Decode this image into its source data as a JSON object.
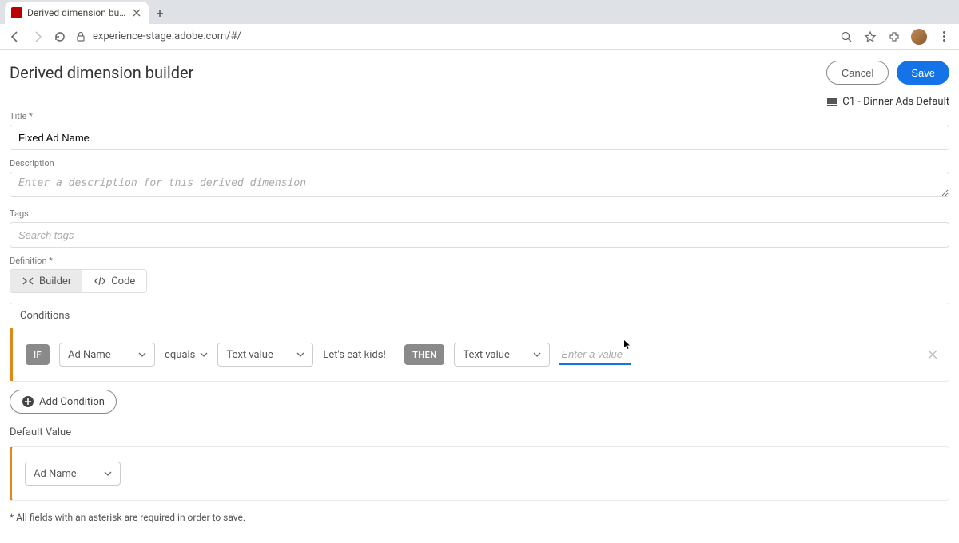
{
  "browser": {
    "tab_title": "Derived dimension builder | Cu",
    "url": "experience-stage.adobe.com/#/"
  },
  "header": {
    "title": "Derived dimension builder",
    "cancel": "Cancel",
    "save": "Save"
  },
  "context": {
    "dataview": "C1 - Dinner Ads Default"
  },
  "fields": {
    "title_label": "Title",
    "title_value": "Fixed Ad Name",
    "description_label": "Description",
    "description_placeholder": "Enter a description for this derived dimension",
    "tags_label": "Tags",
    "tags_placeholder": "Search tags",
    "definition_label": "Definition"
  },
  "tabs": {
    "builder": "Builder",
    "code": "Code"
  },
  "conditions": {
    "section_label": "Conditions",
    "if": "IF",
    "then": "THEN",
    "dimension": "Ad Name",
    "operator": "equals",
    "value_type_left": "Text value",
    "value_left": "Let's eat kids!",
    "value_type_right": "Text value",
    "value_right_placeholder": "Enter a value",
    "add_button": "Add Condition"
  },
  "default_value": {
    "label": "Default Value",
    "dimension": "Ad Name"
  },
  "footnote": "* All fields with an asterisk are required in order to save."
}
